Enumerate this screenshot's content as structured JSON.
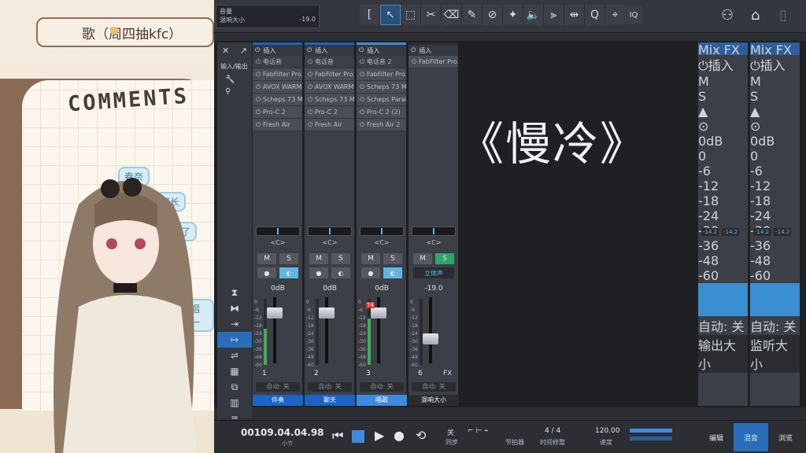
{
  "overlay": {
    "song_banner": "歌（周四抽kfc）",
    "comments_title": "COMMENTS",
    "bubbles": [
      "春奈",
      "魔长",
      "抵了",
      "唱一"
    ]
  },
  "daw": {
    "volume_label": "音量",
    "mix_size_label": "混响大小",
    "mix_size_value": "-19.0",
    "iq_label": "IQ",
    "insert_label": "插入",
    "mix_fx_label": "Mix FX",
    "song_title": "《慢冷》",
    "channels": [
      {
        "insert_header": "插入",
        "inserts": [
          "电话音",
          "FabFilter Pro..",
          "AVOX WARM",
          "Scheps 73 M..",
          "Pro-C 2",
          "Fresh Air"
        ],
        "pan": "<C>",
        "m": "M",
        "s": "S",
        "s_on": false,
        "mono_on": true,
        "db": "0dB",
        "num": "1",
        "auto": "自动: 关",
        "name": "伴奏",
        "meter": 0.55,
        "fader": 0.15,
        "accent": "#1a64c8",
        "clip": ""
      },
      {
        "insert_header": "插入",
        "inserts": [
          "电话音",
          "FabFilter Pro..",
          "AVOX WARM",
          "Scheps 73 M..",
          "Pro-C 2",
          "Fresh Air"
        ],
        "pan": "<C>",
        "m": "M",
        "s": "S",
        "s_on": false,
        "mono_on": false,
        "db": "0dB",
        "num": "2",
        "auto": "自动: 关",
        "name": "聊天",
        "meter": 0,
        "fader": 0.15,
        "accent": "#1a64c8",
        "clip": ""
      },
      {
        "insert_header": "插入",
        "inserts": [
          "电话音 2",
          "FabFilter Pro..",
          "Scheps 73 M..",
          "Scheps Paral..",
          "Pro-C 2 (2)",
          "Fresh Air 2"
        ],
        "pan": "<C>",
        "m": "M",
        "s": "S",
        "s_on": false,
        "mono_on": true,
        "db": "0dB",
        "num": "3",
        "auto": "自动: 关",
        "name": "唱歌",
        "meter": 0.7,
        "fader": 0.15,
        "accent": "#3d8be0",
        "clip": "74"
      },
      {
        "insert_header": "插入",
        "inserts": [
          "FabFilter Pro.."
        ],
        "pan": "<C>",
        "m": "M",
        "s": "S",
        "s_on": true,
        "mono_on": false,
        "stereo": "立体声",
        "db": "-19.0",
        "num": "6",
        "fx": "FX",
        "auto": "自动: 关",
        "name": "混响大小",
        "meter": 0,
        "fader": 0.55,
        "accent": "#2a2c30",
        "clip": ""
      }
    ],
    "output_channels": [
      {
        "top": "Mix FX",
        "insert_header": "插入",
        "peaks": [
          "-14.2",
          "-14.2"
        ],
        "m": "M",
        "s": "S",
        "s_on": true,
        "db": "0dB",
        "auto": "自动: 关",
        "name": "输出大小"
      },
      {
        "top": "Mix FX",
        "insert_header": "插入",
        "peaks": [
          "-14.2",
          "-14.2"
        ],
        "m": "M",
        "s": "S",
        "s_on": false,
        "db": "0dB",
        "auto": "自动: 关",
        "name": "监听大小"
      }
    ],
    "scale": [
      "0",
      "-6",
      "-12",
      "-18",
      "-24",
      "-30",
      "-36",
      "-48",
      "-60"
    ],
    "transport": {
      "timecode": "00109.04.04.98",
      "timecode_unit": "小节",
      "sync_top": "关",
      "sync_label": "同步",
      "metronome_label": "节拍器",
      "time_sig": "4 / 4",
      "time_sig_label": "时间修整",
      "tempo": "120.00",
      "tempo_label": "速度"
    },
    "nav": [
      "编辑",
      "混音",
      "浏览"
    ]
  }
}
